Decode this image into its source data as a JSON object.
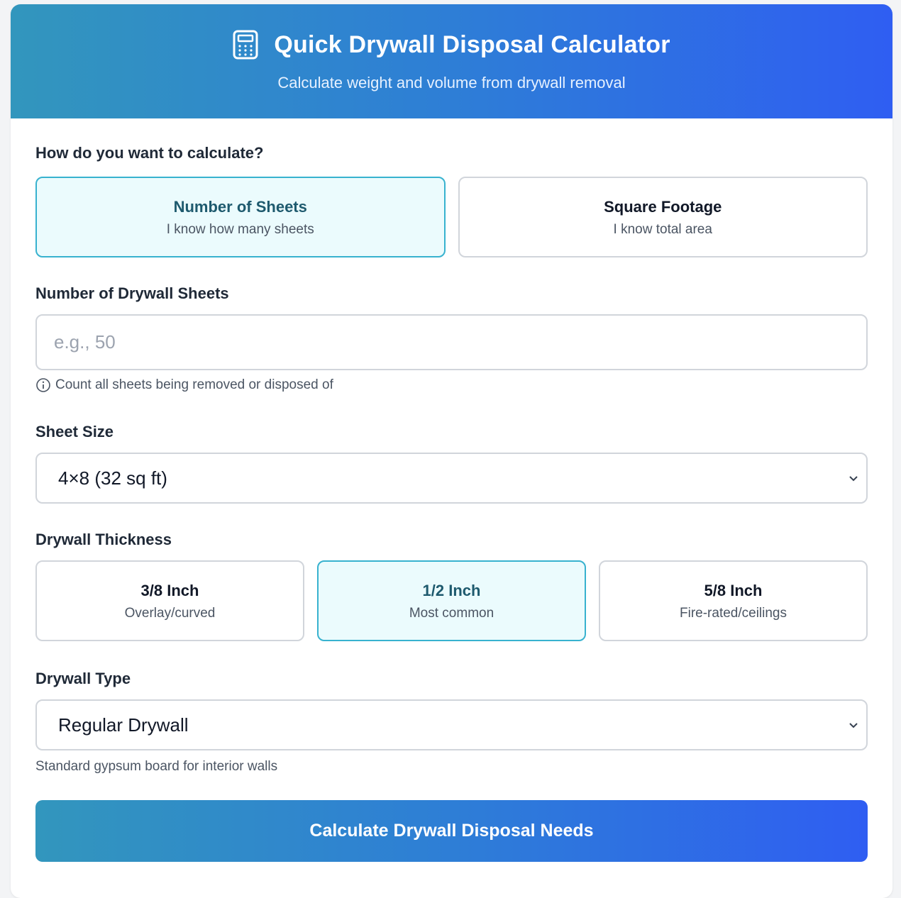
{
  "header": {
    "title": "Quick Drywall Disposal Calculator",
    "subtitle": "Calculate weight and volume from drywall removal",
    "icon": "calculator-icon"
  },
  "mode": {
    "question": "How do you want to calculate?",
    "options": [
      {
        "title": "Number of Sheets",
        "sub": "I know how many sheets",
        "selected": true
      },
      {
        "title": "Square Footage",
        "sub": "I know total area",
        "selected": false
      }
    ]
  },
  "sheets": {
    "label": "Number of Drywall Sheets",
    "placeholder": "e.g., 50",
    "value": "",
    "hint": "Count all sheets being removed or disposed of"
  },
  "sheet_size": {
    "label": "Sheet Size",
    "selected": "4×8 (32 sq ft)"
  },
  "thickness": {
    "label": "Drywall Thickness",
    "options": [
      {
        "title": "3/8 Inch",
        "sub": "Overlay/curved",
        "selected": false
      },
      {
        "title": "1/2 Inch",
        "sub": "Most common",
        "selected": true
      },
      {
        "title": "5/8 Inch",
        "sub": "Fire-rated/ceilings",
        "selected": false
      }
    ]
  },
  "drywall_type": {
    "label": "Drywall Type",
    "selected": "Regular Drywall",
    "note": "Standard gypsum board for interior walls"
  },
  "cta": {
    "label": "Calculate Drywall Disposal Needs"
  },
  "colors": {
    "accent_start": "#3296bd",
    "accent_end": "#2f5ef2",
    "selected_border": "#38b2cf",
    "selected_bg": "#ebfbfd"
  }
}
